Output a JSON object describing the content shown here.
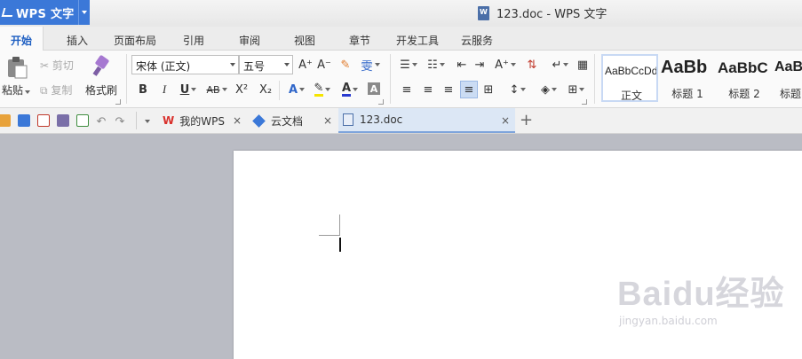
{
  "app": {
    "name": "WPS 文字"
  },
  "window": {
    "title": "123.doc - WPS 文字"
  },
  "menu": {
    "tabs": [
      "开始",
      "插入",
      "页面布局",
      "引用",
      "审阅",
      "视图",
      "章节",
      "开发工具",
      "云服务"
    ],
    "active": "开始"
  },
  "ribbon": {
    "clipboard": {
      "paste": "粘贴",
      "cut": "剪切",
      "copy": "复制",
      "format_painter": "格式刷"
    },
    "font": {
      "family": "宋体 (正文)",
      "size": "五号",
      "bold": "B",
      "italic": "I",
      "underline": "U",
      "strike": "AB",
      "superscript": "X²",
      "subscript": "X₂",
      "grow": "A⁺",
      "shrink": "A⁻",
      "pinyin": "雯"
    },
    "styles": [
      {
        "sample": "AaBbCcDd",
        "caption": "正文"
      },
      {
        "sample": "AaBb",
        "caption": "标题 1"
      },
      {
        "sample": "AaBbC",
        "caption": "标题 2"
      },
      {
        "sample": "AaB",
        "caption": "标题"
      }
    ]
  },
  "doc_tabs": [
    {
      "label": "我的WPS"
    },
    {
      "label": "云文档"
    },
    {
      "label": "123.doc",
      "active": true
    }
  ],
  "watermark": {
    "brand": "Baidu经验",
    "url": "jingyan.baidu.com"
  },
  "colors": {
    "accent": "#3b78d8",
    "workspace": "#babcc4"
  }
}
